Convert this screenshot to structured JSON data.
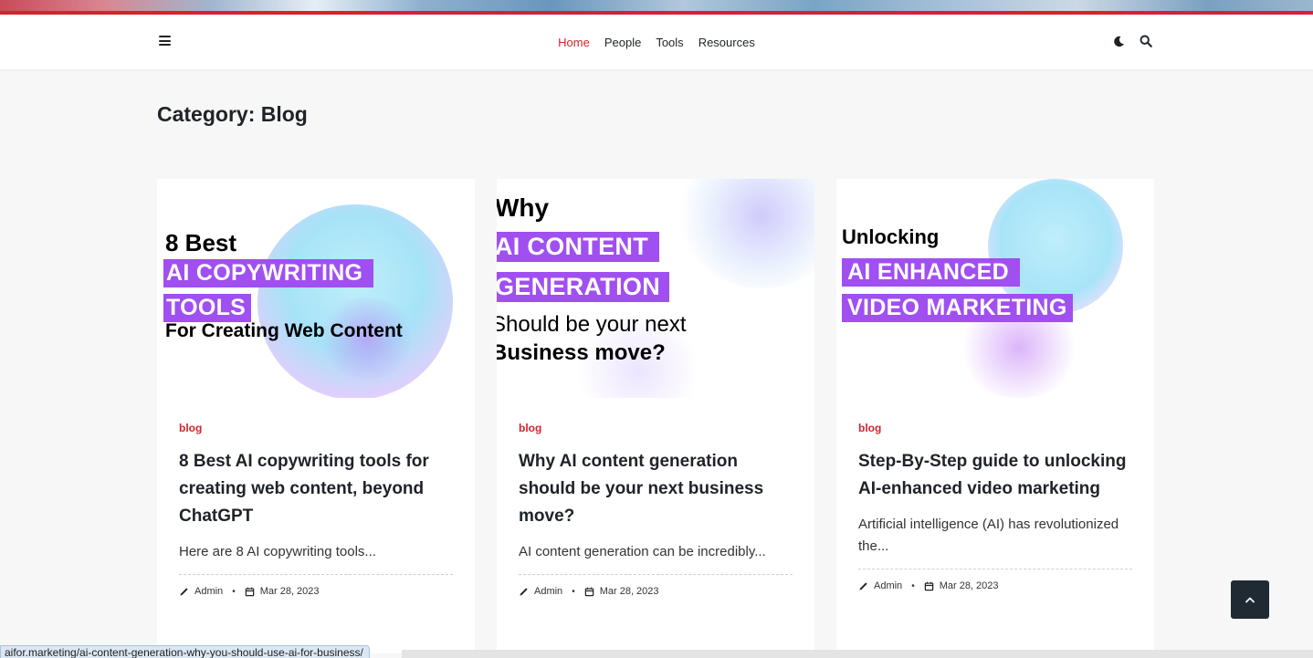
{
  "nav": {
    "items": [
      {
        "label": "Home",
        "active": true
      },
      {
        "label": "People",
        "active": false
      },
      {
        "label": "Tools",
        "active": false
      },
      {
        "label": "Resources",
        "active": false
      }
    ],
    "menu_icon": "hamburger-icon",
    "theme_icon": "moon-icon",
    "search_icon": "search-icon"
  },
  "page": {
    "category_title": "Category: Blog"
  },
  "colors": {
    "accent": "#d5232e",
    "highlight": "#a04ff0",
    "scroll_button": "#1f2a33"
  },
  "posts": [
    {
      "image": {
        "line1": "8 Best",
        "hl1": "AI COPYWRITING",
        "hl2": "TOOLS",
        "line2": "For Creating Web Content"
      },
      "category": "blog",
      "title": "8 Best AI copywriting tools for creating web content, beyond ChatGPT",
      "excerpt": "Here are 8 AI copywriting tools...",
      "author": "Admin",
      "date": "Mar 28, 2023"
    },
    {
      "image": {
        "line1": "Why",
        "hl1": "AI CONTENT",
        "hl2": "GENERATION",
        "line2": "Should be your next",
        "line3": "Business move?"
      },
      "category": "blog",
      "title": "Why AI content generation should be your next business move?",
      "excerpt": "AI content generation can be incredibly...",
      "author": "Admin",
      "date": "Mar 28, 2023"
    },
    {
      "image": {
        "line1": "Unlocking",
        "hl1": "AI ENHANCED",
        "hl2": "VIDEO MARKETING"
      },
      "category": "blog",
      "title": "Step-By-Step guide to unlocking AI-enhanced video marketing",
      "excerpt": "Artificial intelligence (AI) has revolutionized the...",
      "author": "Admin",
      "date": "Mar 28, 2023"
    }
  ],
  "status_bar": {
    "url": "aifor.marketing/ai-content-generation-why-you-should-use-ai-for-business/"
  }
}
